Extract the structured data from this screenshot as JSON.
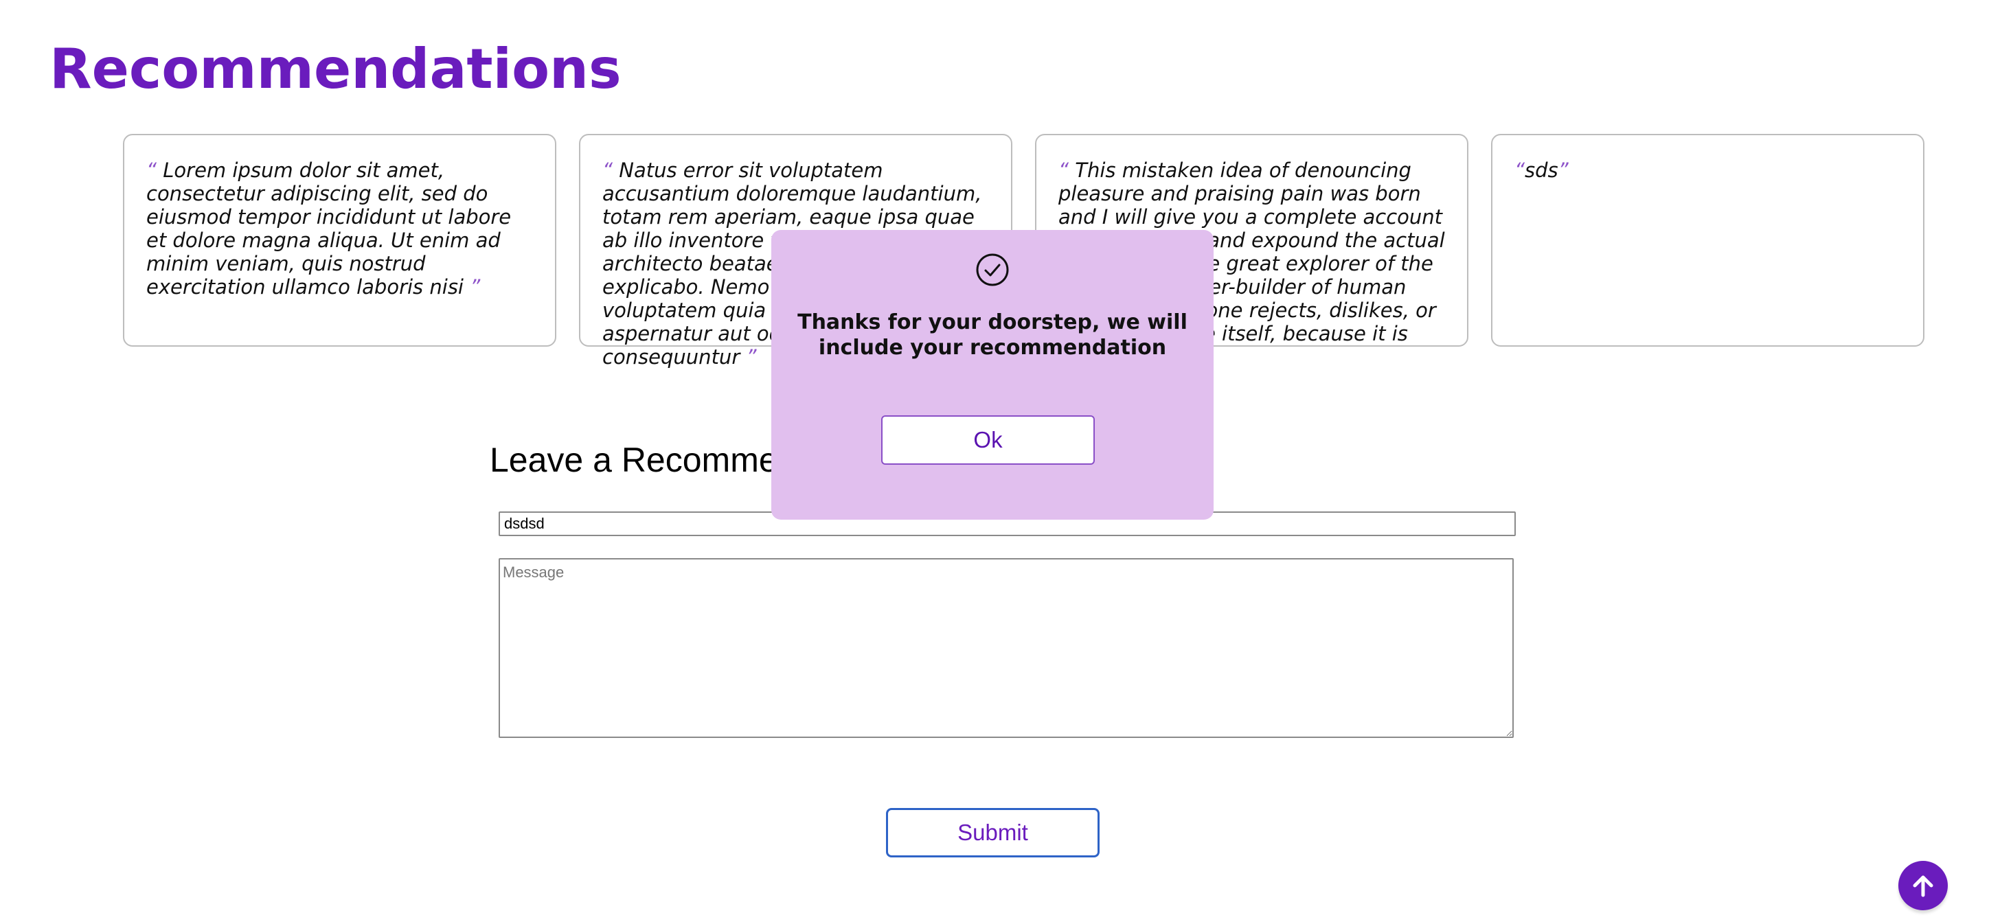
{
  "page_title": "Recommendations",
  "cards": [
    {
      "open_quote": "“",
      "text": " Lorem ipsum dolor sit amet, consectetur adipiscing elit, sed do eiusmod tempor incididunt ut labore et dolore magna aliqua. Ut enim ad minim veniam, quis nostrud exercitation ullamco laboris nisi ",
      "close_quote": "”"
    },
    {
      "open_quote": "“",
      "text": " Natus error sit voluptatem accusantium doloremque laudantium, totam rem aperiam, eaque ipsa quae ab illo inventore veritatis et quasi architecto beatae vitae dicta sunt explicabo. Nemo enim ipsam voluptatem quia voluptas sit aspernatur aut odit aut fugit, sed quia consequuntur ",
      "close_quote": "”"
    },
    {
      "open_quote": "“",
      "text": " This mistaken idea of denouncing pleasure and praising pain was born and I will give you a complete account of the system, and expound the actual teachings of the great explorer of the truth, the master-builder of human happiness. No one rejects, dislikes, or avoids pleasure itself, because it is pleasure, ",
      "close_quote": "”"
    },
    {
      "open_quote": "“",
      "text": "sds",
      "close_quote": "”"
    }
  ],
  "form": {
    "title": "Leave a Recommendation",
    "name_value": "dsdsd",
    "message_placeholder": "Message",
    "submit_label": "Submit"
  },
  "modal": {
    "icon": "check-circle-icon",
    "message": "Thanks for your doorstep, we will include your recommendation",
    "ok_label": "Ok"
  },
  "scroll_top": {
    "icon": "arrow-up-icon"
  },
  "colors": {
    "accent": "#6a1cbd",
    "modal_background": "#e1bfee",
    "quote_mark": "#8d52c9",
    "submit_border": "#2e63c7"
  }
}
